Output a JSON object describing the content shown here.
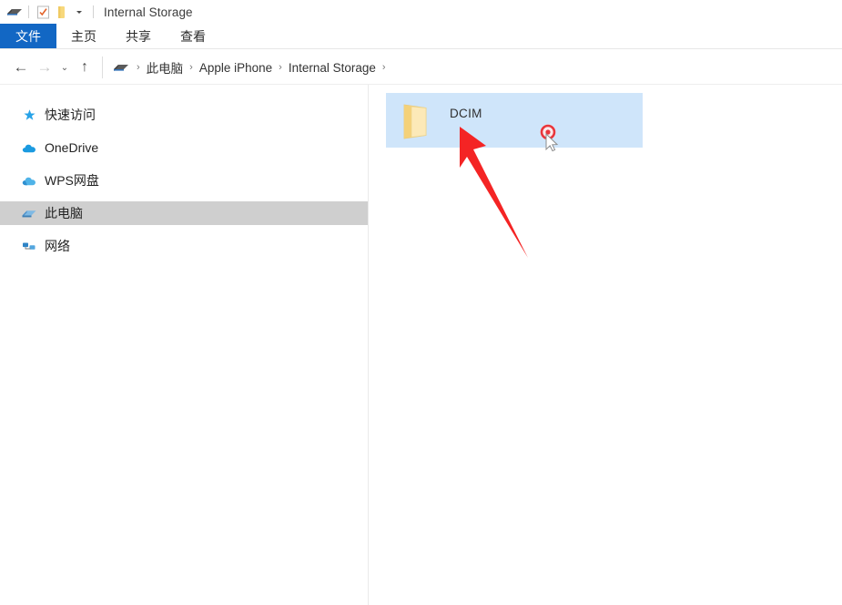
{
  "window": {
    "title": "Internal Storage",
    "quick_access": [
      {
        "name": "properties-icon",
        "glyph": "disk"
      },
      {
        "name": "checklist-icon",
        "glyph": "checkbox"
      },
      {
        "name": "new-folder-icon",
        "glyph": "folder"
      },
      {
        "name": "customize-chevron-icon",
        "glyph": "chevron-down"
      }
    ]
  },
  "ribbon": {
    "tabs": [
      {
        "label": "文件",
        "name": "tab-file",
        "active": true
      },
      {
        "label": "主页",
        "name": "tab-home",
        "active": false
      },
      {
        "label": "共享",
        "name": "tab-share",
        "active": false
      },
      {
        "label": "查看",
        "name": "tab-view",
        "active": false
      }
    ]
  },
  "address_bar": {
    "back_glyph": "←",
    "forward_glyph": "→",
    "recent_glyph": "⌄",
    "up_glyph": "↑",
    "breadcrumb": [
      {
        "label": "此电脑",
        "name": "breadcrumb-this-pc"
      },
      {
        "label": "Apple iPhone",
        "name": "breadcrumb-apple-iphone"
      },
      {
        "label": "Internal Storage",
        "name": "breadcrumb-internal-storage"
      }
    ],
    "separator": "›"
  },
  "sidebar": {
    "items": [
      {
        "label": "快速访问",
        "name": "sidebar-item-quick-access",
        "icon": "star-icon",
        "selected": false
      },
      {
        "label": "OneDrive",
        "name": "sidebar-item-onedrive",
        "icon": "cloud-icon",
        "selected": false
      },
      {
        "label": "WPS网盘",
        "name": "sidebar-item-wps-cloud",
        "icon": "cloud-icon",
        "selected": false
      },
      {
        "label": "此电脑",
        "name": "sidebar-item-this-pc",
        "icon": "pc-icon",
        "selected": true
      },
      {
        "label": "网络",
        "name": "sidebar-item-network",
        "icon": "network-icon",
        "selected": false
      }
    ]
  },
  "content": {
    "items": [
      {
        "label": "DCIM",
        "name": "file-item-dcim",
        "icon": "folder-icon",
        "selected": true
      }
    ]
  },
  "annotation": {
    "arrow_color": "#f42424",
    "cursor_marker_color": "#e8363c"
  },
  "colors": {
    "accent_blue": "#1267c4",
    "selection_blue": "#cfe5fa",
    "sidebar_selected": "#cfcfcf",
    "folder_yellow": "#f6d27f"
  }
}
